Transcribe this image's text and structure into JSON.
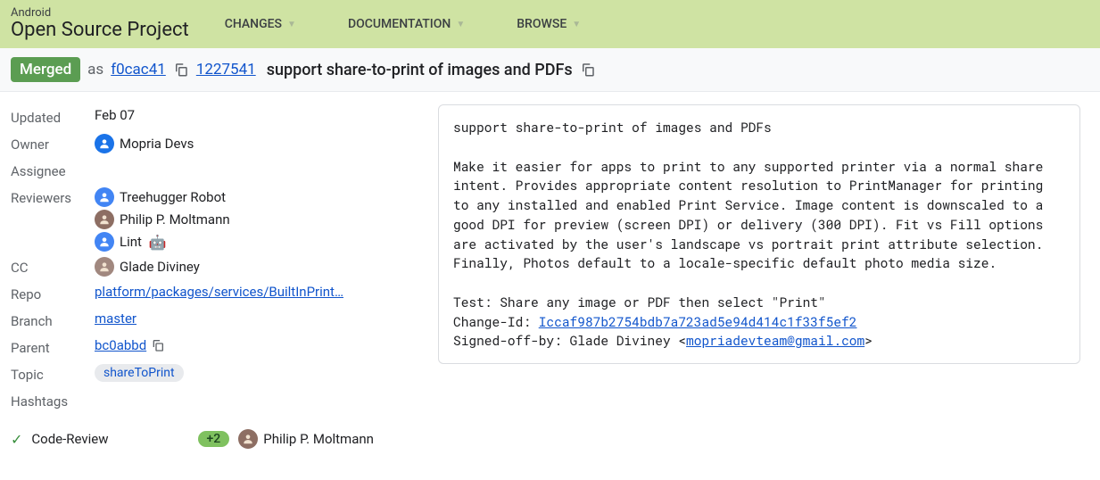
{
  "header": {
    "logo_top": "Android",
    "logo_bottom": "Open Source Project",
    "nav": [
      {
        "label": "CHANGES"
      },
      {
        "label": "DOCUMENTATION"
      },
      {
        "label": "BROWSE"
      }
    ]
  },
  "change": {
    "status": "Merged",
    "as_text": "as",
    "commit_sha": "f0cac41",
    "change_number": "1227541",
    "title": "support share-to-print of images and PDFs"
  },
  "metadata": {
    "updated_label": "Updated",
    "updated_value": "Feb 07",
    "owner_label": "Owner",
    "owner_name": "Mopria Devs",
    "assignee_label": "Assignee",
    "reviewers_label": "Reviewers",
    "reviewers": [
      {
        "name": "Treehugger Robot",
        "avatar_class": "avatar-blue2",
        "emoji": ""
      },
      {
        "name": "Philip P. Moltmann",
        "avatar_class": "avatar-photo",
        "emoji": ""
      },
      {
        "name": "Lint",
        "avatar_class": "avatar-blue2",
        "emoji": "🤖"
      }
    ],
    "cc_label": "CC",
    "cc": [
      {
        "name": "Glade Diviney",
        "avatar_class": "avatar-photo2"
      }
    ],
    "repo_label": "Repo",
    "repo_value": "platform/packages/services/BuiltInPrint…",
    "branch_label": "Branch",
    "branch_value": "master",
    "parent_label": "Parent",
    "parent_value": "bc0abbd",
    "topic_label": "Topic",
    "topic_value": "shareToPrint",
    "hashtags_label": "Hashtags"
  },
  "commit_message": {
    "subject": "support share-to-print of images and PDFs",
    "body": "Make it easier for apps to print to any supported printer via a normal share intent. Provides appropriate content resolution to PrintManager for printing to any installed and enabled Print Service. Image content is downscaled to a good DPI for preview (screen DPI) or delivery (300 DPI). Fit vs Fill options are activated by the user's landscape vs portrait print attribute selection. Finally, Photos default to a locale-specific default photo media size.",
    "test_line": "Test: Share any image or PDF then select \"Print\"",
    "changeid_label": "Change-Id: ",
    "changeid_value": "Iccaf987b2754bdb7a723ad5e94d414c1f33f5ef2",
    "signed_off_prefix": "Signed-off-by: Glade Diviney <",
    "signed_off_email": "mopriadevteam@gmail.com",
    "signed_off_suffix": ">"
  },
  "review": {
    "label": "Code-Review",
    "vote": "+2",
    "voter": "Philip P. Moltmann"
  }
}
